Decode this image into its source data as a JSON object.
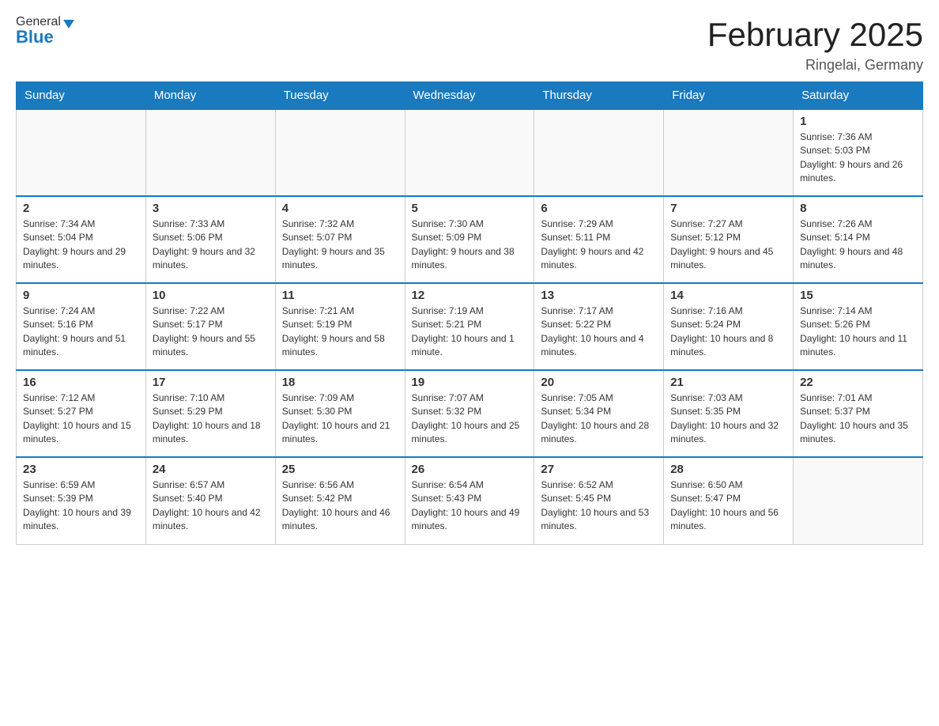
{
  "logo": {
    "general": "General",
    "blue": "Blue"
  },
  "title": {
    "month_year": "February 2025",
    "location": "Ringelai, Germany"
  },
  "weekdays": [
    "Sunday",
    "Monday",
    "Tuesday",
    "Wednesday",
    "Thursday",
    "Friday",
    "Saturday"
  ],
  "weeks": [
    [
      {
        "day": "",
        "info": ""
      },
      {
        "day": "",
        "info": ""
      },
      {
        "day": "",
        "info": ""
      },
      {
        "day": "",
        "info": ""
      },
      {
        "day": "",
        "info": ""
      },
      {
        "day": "",
        "info": ""
      },
      {
        "day": "1",
        "info": "Sunrise: 7:36 AM\nSunset: 5:03 PM\nDaylight: 9 hours and 26 minutes."
      }
    ],
    [
      {
        "day": "2",
        "info": "Sunrise: 7:34 AM\nSunset: 5:04 PM\nDaylight: 9 hours and 29 minutes."
      },
      {
        "day": "3",
        "info": "Sunrise: 7:33 AM\nSunset: 5:06 PM\nDaylight: 9 hours and 32 minutes."
      },
      {
        "day": "4",
        "info": "Sunrise: 7:32 AM\nSunset: 5:07 PM\nDaylight: 9 hours and 35 minutes."
      },
      {
        "day": "5",
        "info": "Sunrise: 7:30 AM\nSunset: 5:09 PM\nDaylight: 9 hours and 38 minutes."
      },
      {
        "day": "6",
        "info": "Sunrise: 7:29 AM\nSunset: 5:11 PM\nDaylight: 9 hours and 42 minutes."
      },
      {
        "day": "7",
        "info": "Sunrise: 7:27 AM\nSunset: 5:12 PM\nDaylight: 9 hours and 45 minutes."
      },
      {
        "day": "8",
        "info": "Sunrise: 7:26 AM\nSunset: 5:14 PM\nDaylight: 9 hours and 48 minutes."
      }
    ],
    [
      {
        "day": "9",
        "info": "Sunrise: 7:24 AM\nSunset: 5:16 PM\nDaylight: 9 hours and 51 minutes."
      },
      {
        "day": "10",
        "info": "Sunrise: 7:22 AM\nSunset: 5:17 PM\nDaylight: 9 hours and 55 minutes."
      },
      {
        "day": "11",
        "info": "Sunrise: 7:21 AM\nSunset: 5:19 PM\nDaylight: 9 hours and 58 minutes."
      },
      {
        "day": "12",
        "info": "Sunrise: 7:19 AM\nSunset: 5:21 PM\nDaylight: 10 hours and 1 minute."
      },
      {
        "day": "13",
        "info": "Sunrise: 7:17 AM\nSunset: 5:22 PM\nDaylight: 10 hours and 4 minutes."
      },
      {
        "day": "14",
        "info": "Sunrise: 7:16 AM\nSunset: 5:24 PM\nDaylight: 10 hours and 8 minutes."
      },
      {
        "day": "15",
        "info": "Sunrise: 7:14 AM\nSunset: 5:26 PM\nDaylight: 10 hours and 11 minutes."
      }
    ],
    [
      {
        "day": "16",
        "info": "Sunrise: 7:12 AM\nSunset: 5:27 PM\nDaylight: 10 hours and 15 minutes."
      },
      {
        "day": "17",
        "info": "Sunrise: 7:10 AM\nSunset: 5:29 PM\nDaylight: 10 hours and 18 minutes."
      },
      {
        "day": "18",
        "info": "Sunrise: 7:09 AM\nSunset: 5:30 PM\nDaylight: 10 hours and 21 minutes."
      },
      {
        "day": "19",
        "info": "Sunrise: 7:07 AM\nSunset: 5:32 PM\nDaylight: 10 hours and 25 minutes."
      },
      {
        "day": "20",
        "info": "Sunrise: 7:05 AM\nSunset: 5:34 PM\nDaylight: 10 hours and 28 minutes."
      },
      {
        "day": "21",
        "info": "Sunrise: 7:03 AM\nSunset: 5:35 PM\nDaylight: 10 hours and 32 minutes."
      },
      {
        "day": "22",
        "info": "Sunrise: 7:01 AM\nSunset: 5:37 PM\nDaylight: 10 hours and 35 minutes."
      }
    ],
    [
      {
        "day": "23",
        "info": "Sunrise: 6:59 AM\nSunset: 5:39 PM\nDaylight: 10 hours and 39 minutes."
      },
      {
        "day": "24",
        "info": "Sunrise: 6:57 AM\nSunset: 5:40 PM\nDaylight: 10 hours and 42 minutes."
      },
      {
        "day": "25",
        "info": "Sunrise: 6:56 AM\nSunset: 5:42 PM\nDaylight: 10 hours and 46 minutes."
      },
      {
        "day": "26",
        "info": "Sunrise: 6:54 AM\nSunset: 5:43 PM\nDaylight: 10 hours and 49 minutes."
      },
      {
        "day": "27",
        "info": "Sunrise: 6:52 AM\nSunset: 5:45 PM\nDaylight: 10 hours and 53 minutes."
      },
      {
        "day": "28",
        "info": "Sunrise: 6:50 AM\nSunset: 5:47 PM\nDaylight: 10 hours and 56 minutes."
      },
      {
        "day": "",
        "info": ""
      }
    ]
  ]
}
